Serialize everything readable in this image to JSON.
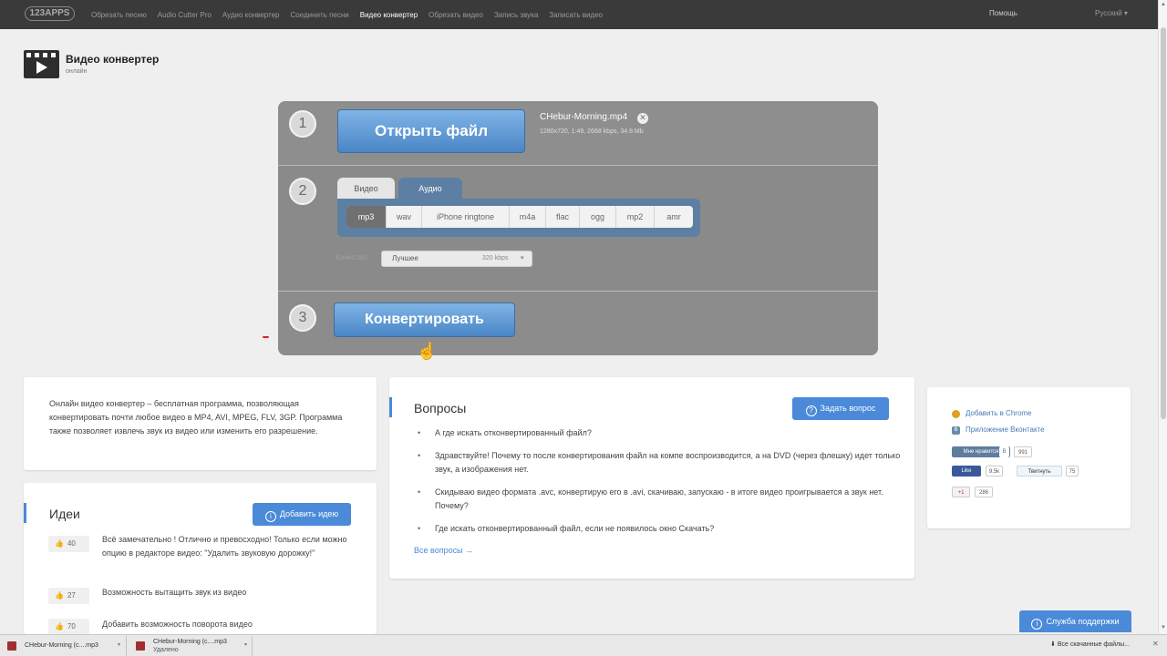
{
  "nav": {
    "logo": "123APPS",
    "items": [
      "Обрезать песню",
      "Audio Cutter Pro",
      "Аудио конвертер",
      "Соединить песни",
      "Видео конвертер",
      "Обрезать видео",
      "Запись звука",
      "Записать видео"
    ],
    "active_index": 4,
    "help": "Помощь",
    "language": "Русский ▾"
  },
  "header": {
    "title": "Видео конвертер",
    "subtitle": "онлайн"
  },
  "converter": {
    "step1": {
      "number": "1",
      "open_label": "Открыть файл",
      "file_name": "CHebur-Morning.mp4",
      "file_meta": "1280x720, 1:49, 2668 kbps, 34.8 Mb"
    },
    "step2": {
      "number": "2",
      "tab_video": "Видео",
      "tab_audio": "Аудио",
      "formats": [
        "mp3",
        "wav",
        "iPhone ringtone",
        "m4a",
        "flac",
        "ogg",
        "mp2",
        "amr"
      ],
      "active_format": "mp3",
      "quality_label": "Качество:",
      "quality_value": "Лучшее",
      "quality_kbps": "320 kbps"
    },
    "step3": {
      "number": "3",
      "convert_label": "Конвертировать"
    }
  },
  "about": {
    "text": "Онлайн видео конвертер – бесплатная программа, позволяющая конвертировать почти любое видео в MP4, AVI, MPEG, FLV, 3GP. Программа также позволяет извлечь звук из видео или изменить его разрешение."
  },
  "ideas": {
    "title": "Идеи",
    "add_label": "Добавить идею",
    "items": [
      {
        "votes": "40",
        "text": "Всё замечательно ! Отлично и превосходно! Только если можно опцию в редакторе видео: \"Удалить звуковую дорожку!\""
      },
      {
        "votes": "27",
        "text": "Возможность вытащить звук из видео"
      },
      {
        "votes": "70",
        "text": "Добавить возможность поворота видео"
      }
    ]
  },
  "faq": {
    "title": "Вопросы",
    "ask_label": "Задать вопрос",
    "questions": [
      "А где искать отконвертированный файл?",
      "Здравствуйте! Почему то после конвертирования файл на компе воспроизводится, а на DVD (через флешку) идет только звук, а изображения нет.",
      "Скидываю видео формата .avc, конвертирую его в .avi, скачиваю, запускаю - в итоге видео проигрывается а звук нет. Почему?",
      "Где искать отконвертированный файл, если не появилось окно Скачать?"
    ],
    "all_label": "Все вопросы →"
  },
  "side": {
    "chrome_label": "Добавить в Chrome",
    "vk_app_label": "Приложение Вконтакте",
    "vk_like": "Мне нравится",
    "vk_count": "991",
    "fb_like": "Like",
    "fb_count": "9.5k",
    "tweet": "Твитнуть",
    "tweet_count": "75",
    "gplus": "+1",
    "gplus_count": "286"
  },
  "support_label": "Служба поддержки",
  "downloads": {
    "items": [
      {
        "name": "CHebur-Morning (c....mp3",
        "sub": ""
      },
      {
        "name": "CHebur-Morning (c....mp3",
        "sub": "Удалено"
      }
    ],
    "all_label": "Все скачанные файлы..."
  }
}
